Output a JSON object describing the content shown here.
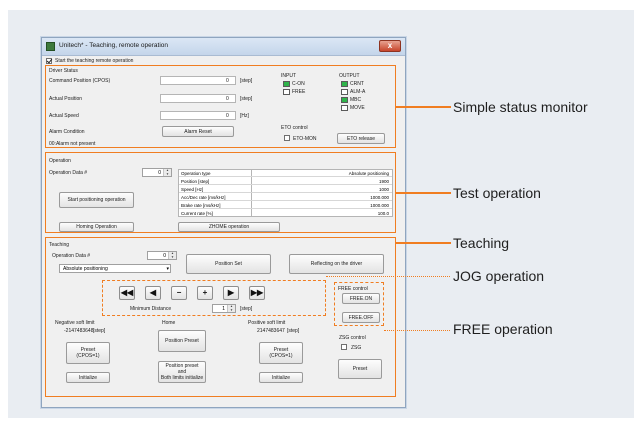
{
  "window": {
    "title": "Unitech* - Teaching, remote operation",
    "close": "x",
    "start_checkbox": "Start the teaching remote operation"
  },
  "driver_status": {
    "heading": "Driver Status",
    "command_position_label": "Command Position (CPOS)",
    "command_position_value": "0",
    "command_position_unit": "[step]",
    "actual_position_label": "Actual Position",
    "actual_position_value": "0",
    "actual_position_unit": "[step]",
    "actual_speed_label": "Actual Speed",
    "actual_speed_value": "0",
    "actual_speed_unit": "[Hz]",
    "alarm_condition_label": "Alarm Condition",
    "alarm_reset_button": "Alarm Reset",
    "no_alarm_text": "00:Alarm not present",
    "input_heading": "INPUT",
    "input_items": [
      "C-ON",
      "FREE"
    ],
    "output_heading": "OUTPUT",
    "output_items": [
      "CRNT",
      "ALM-A",
      "MBC",
      "MOVE"
    ],
    "eto_control_label": "ETO control",
    "eto_mon_label": "ETO-MON",
    "eto_release_button": "ETO release"
  },
  "operation": {
    "heading": "Operation",
    "data_label": "Operation Data #",
    "data_value": "0",
    "start_button": "Start positioning operation",
    "table": [
      {
        "key": "Operation type",
        "value": "Absolute positioning"
      },
      {
        "key": "Position [step]",
        "value": "1900"
      },
      {
        "key": "Speed [Hz]",
        "value": "1000"
      },
      {
        "key": "Acc/Dec rate [ms/kHz]",
        "value": "1000.000"
      },
      {
        "key": "Brake rate [ms/kHz]",
        "value": "1000.000"
      },
      {
        "key": "Current rate [%]",
        "value": "100.0"
      }
    ],
    "homing_button": "Homing Operation",
    "zhome_button": "ZHOME operation"
  },
  "teaching": {
    "heading": "Teaching",
    "data_label": "Operation Data #",
    "data_value": "0",
    "combo_value": "Absolute positioning",
    "position_set_button": "Position Set",
    "reflecting_button": "Reflecting on the driver",
    "min_distance_label": "Minimum Distance",
    "min_distance_value": "1",
    "min_distance_unit": "[step]",
    "jog_buttons": [
      "◀◀",
      "◀",
      "−",
      "+",
      "▶",
      "▶▶"
    ],
    "free_control_label": "FREE control",
    "free_on_button": "FREE.ON",
    "free_off_button": "FREE.OFF",
    "negative_limit_label": "Negative soft limit",
    "negative_limit_value": "-2147483648",
    "negative_limit_unit": "[step]",
    "home_label": "Home",
    "positive_limit_label": "Positive soft limit",
    "positive_limit_value": "2147483647",
    "positive_limit_unit": "[step]",
    "preset_cpos_left": "Preset\n(CPOS=1)",
    "position_preset_button": "Position Preset",
    "preset_cpos_right": "Preset\n(CPOS=1)",
    "zsg_control_label": "ZSG control",
    "zsg_label": "ZSG",
    "initialize_left": "Initialize",
    "position_preset_init_button": "Position preset\nand\nBoth limits initialize",
    "initialize_right": "Initialize",
    "preset_button": "Preset"
  },
  "callouts": {
    "simple_status_monitor": "Simple status monitor",
    "test_operation": "Test operation",
    "teaching": "Teaching",
    "jog_operation": "JOG operation",
    "free_operation": "FREE operation"
  },
  "colors": {
    "accent": "#f07d21",
    "led_on": "#2fb44b",
    "background": "#e9edf2"
  }
}
